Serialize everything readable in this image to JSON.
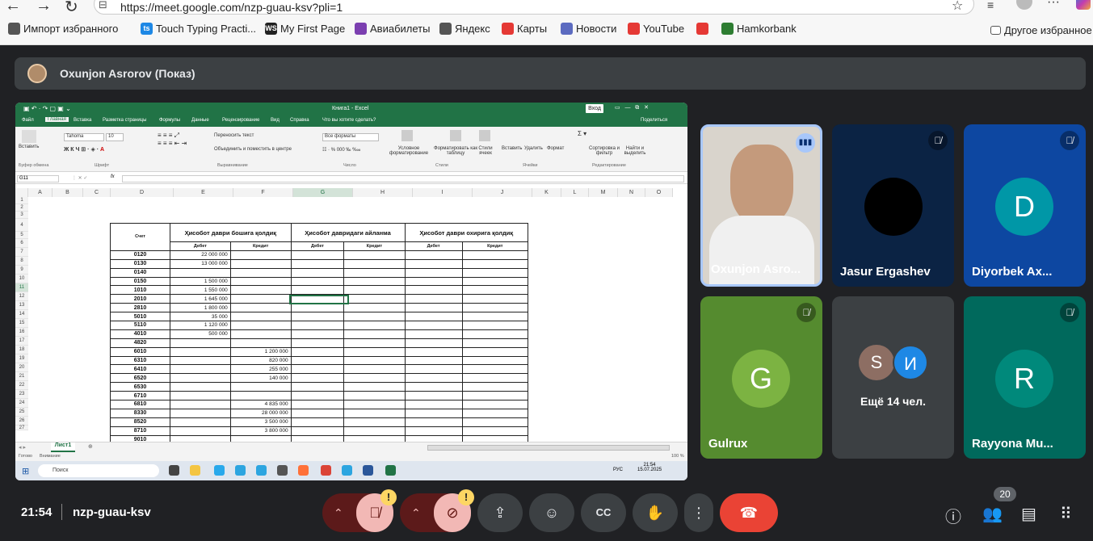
{
  "browser": {
    "url": "https://meet.google.com/nzp-guau-ksv?pli=1",
    "bookmarks": [
      {
        "label": "Импорт избранного",
        "icon": "import-icon",
        "color": "#555555"
      },
      {
        "label": "Touch Typing Practi...",
        "icon": "ts",
        "color": "#1e88e5"
      },
      {
        "label": "My First Page",
        "icon": "WS",
        "color": "#222222"
      },
      {
        "label": "Авиабилеты",
        "icon": "plane-icon",
        "color": "#7b3fb0"
      },
      {
        "label": "Яндекс",
        "icon": "globe-icon",
        "color": "#555555"
      },
      {
        "label": "Карты",
        "icon": "map-icon",
        "color": "#e53935"
      },
      {
        "label": "Новости",
        "icon": "news-icon",
        "color": "#5c6bc0"
      },
      {
        "label": "YouTube",
        "icon": "youtube-icon",
        "color": "#e53935"
      },
      {
        "label": "",
        "icon": "youtube-icon",
        "color": "#e53935"
      },
      {
        "label": "Hamkorbank",
        "icon": "hamkorbank-icon",
        "color": "#2e7d32"
      }
    ],
    "other_bookmarks": "Другое избранное"
  },
  "meet": {
    "presenter": "Oxunjon Asrorov (Показ)",
    "clock": "21:54",
    "meeting_code": "nzp-guau-ksv",
    "participant_count": "20",
    "tiles": [
      {
        "name": "Oxunjon Asro...",
        "type": "video",
        "active": true
      },
      {
        "name": "Jasur Ergashev",
        "type": "dark-avatar",
        "muted": true
      },
      {
        "name": "Diyorbek Ax...",
        "avatar": "D",
        "bg": "#0d47a1",
        "avatar_color": "#0097a7",
        "muted": true
      },
      {
        "name": "Gulrux",
        "avatar": "G",
        "bg": "#558b2f",
        "avatar_color": "#7cb342",
        "muted": true
      },
      {
        "name": "Rayyona Mu...",
        "avatar": "R",
        "bg": "#00695c",
        "avatar_color": "#00897b",
        "muted": true
      }
    ],
    "more": {
      "label": "Ещё 14 чел.",
      "avatars": [
        "S",
        "И"
      ]
    },
    "controls": {
      "warn": "!"
    }
  },
  "excel": {
    "title": "Книга1 - Excel",
    "login": "Вход",
    "tabs": [
      "Файл",
      "Главная",
      "Вставка",
      "Разметка страницы",
      "Формулы",
      "Данные",
      "Рецензирование",
      "Вид",
      "Справка",
      "Что вы хотите сделать?",
      "Поделиться"
    ],
    "ribbon": {
      "paste": "Вставить",
      "font": "Tahoma",
      "size": "10",
      "wrap": "Переносить текст",
      "merge": "Объединить и поместить в центре",
      "format": "Все форматы",
      "cond": "Условное форматирование",
      "as_table": "Форматировать как таблицу",
      "styles": "Стили ячеек",
      "insert": "Вставить",
      "delete": "Удалить",
      "fmt": "Формат",
      "sort": "Сортировка и фильтр",
      "find": "Найти и выделить",
      "groups": [
        "Буфер обмена",
        "Шрифт",
        "Выравнивание",
        "Число",
        "Стили",
        "Ячейки",
        "Редактирование"
      ]
    },
    "name_box": "G11",
    "fx": "fx",
    "columns": [
      "A",
      "B",
      "C",
      "D",
      "E",
      "F",
      "G",
      "H",
      "I",
      "J",
      "K",
      "L",
      "M",
      "N",
      "O"
    ],
    "rows": [
      "1",
      "2",
      "3",
      "4",
      "5",
      "6",
      "7",
      "8",
      "9",
      "10",
      "11",
      "12",
      "13",
      "14",
      "15",
      "16",
      "17",
      "18",
      "19",
      "20",
      "21",
      "22",
      "23",
      "24",
      "25",
      "26",
      "27"
    ],
    "table": {
      "account_header": "Счет",
      "groups": [
        "Ҳисобот даври бошига қолдиқ",
        "Ҳисобот давридаги айланма",
        "Ҳисобот даври охирига қолдиқ"
      ],
      "debit": "Дебет",
      "credit": "Кредит",
      "rows": [
        {
          "acc": "0120",
          "debit": "22 000 000",
          "credit": ""
        },
        {
          "acc": "0130",
          "debit": "13 000 000",
          "credit": ""
        },
        {
          "acc": "0140",
          "debit": "",
          "credit": ""
        },
        {
          "acc": "0150",
          "debit": "1 500 000",
          "credit": ""
        },
        {
          "acc": "1010",
          "debit": "1 550 000",
          "credit": ""
        },
        {
          "acc": "2010",
          "debit": "1 645 000",
          "credit": ""
        },
        {
          "acc": "2810",
          "debit": "1 800 000",
          "credit": ""
        },
        {
          "acc": "5010",
          "debit": "35 000",
          "credit": ""
        },
        {
          "acc": "5110",
          "debit": "1 120 000",
          "credit": ""
        },
        {
          "acc": "4010",
          "debit": "500 000",
          "credit": ""
        },
        {
          "acc": "4820",
          "debit": "",
          "credit": ""
        },
        {
          "acc": "6010",
          "debit": "",
          "credit": "1 200 000"
        },
        {
          "acc": "6310",
          "debit": "",
          "credit": "820 000"
        },
        {
          "acc": "6410",
          "debit": "",
          "credit": "255 000"
        },
        {
          "acc": "6520",
          "debit": "",
          "credit": "140 000"
        },
        {
          "acc": "6530",
          "debit": "",
          "credit": ""
        },
        {
          "acc": "6710",
          "debit": "",
          "credit": ""
        },
        {
          "acc": "6810",
          "debit": "",
          "credit": "4 835 000"
        },
        {
          "acc": "8330",
          "debit": "",
          "credit": "28 000 000"
        },
        {
          "acc": "8520",
          "debit": "",
          "credit": "3 500 000"
        },
        {
          "acc": "8710",
          "debit": "",
          "credit": "3 800 000"
        },
        {
          "acc": "9010",
          "debit": "",
          "credit": ""
        }
      ]
    },
    "sheet_tab": "Лист1",
    "status_left": "Готово",
    "status_access": "Внимание",
    "zoom": "100 %",
    "taskbar": {
      "search": "Поиск",
      "lang": "РУС",
      "time": "21:54",
      "date": "15.07.2025"
    }
  }
}
